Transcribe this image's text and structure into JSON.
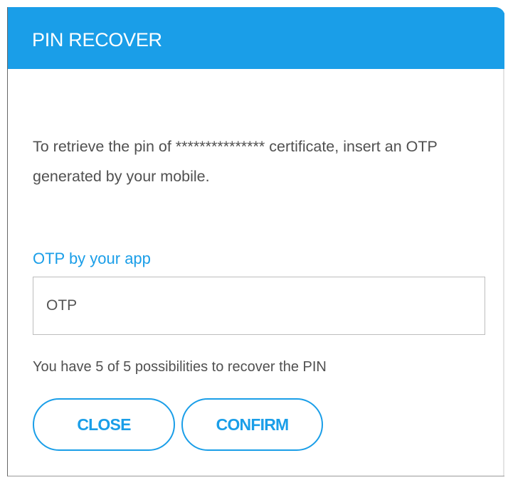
{
  "dialog": {
    "title": "PIN RECOVER",
    "description": "To retrieve the pin of *************** certificate, insert an OTP generated by your mobile.",
    "field_label": "OTP by your app",
    "otp_input": {
      "value": "",
      "placeholder": "OTP"
    },
    "attempts_text": "You have 5 of 5 possibilities to recover the PIN",
    "close_label": "CLOSE",
    "confirm_label": "CONFIRM"
  },
  "colors": {
    "accent": "#1a9ee8",
    "text": "#505050",
    "border": "#bdbdbd"
  }
}
